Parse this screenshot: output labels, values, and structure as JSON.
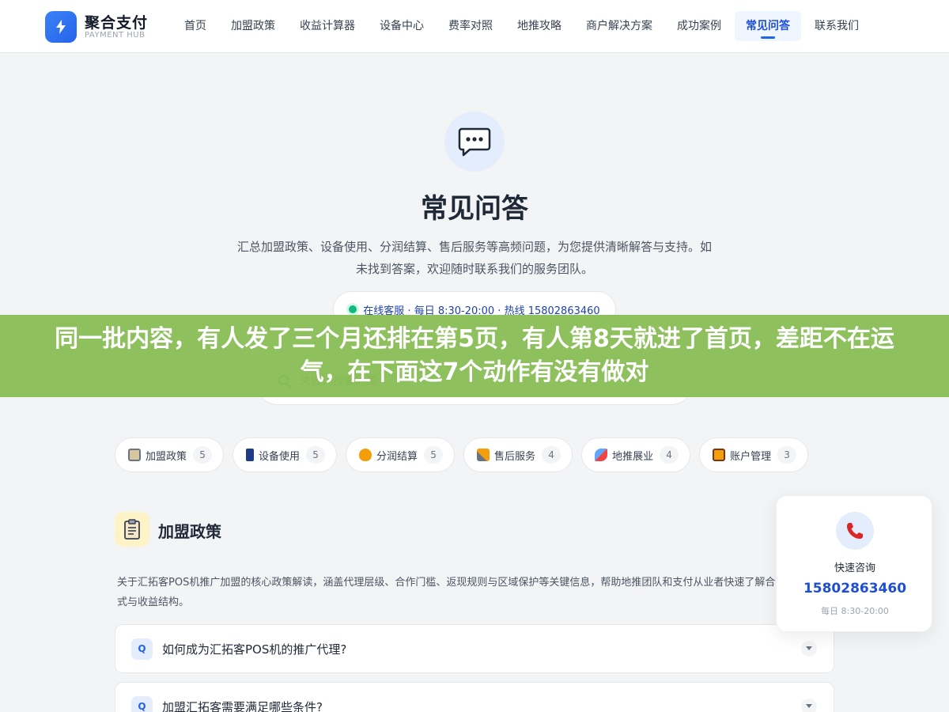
{
  "header": {
    "brand_name": "聚合支付",
    "brand_sub": "PAYMENT HUB",
    "logo_icon": "lightning-icon",
    "nav": [
      {
        "label": "首页"
      },
      {
        "label": "加盟政策"
      },
      {
        "label": "收益计算器"
      },
      {
        "label": "设备中心"
      },
      {
        "label": "费率对照"
      },
      {
        "label": "地推攻略"
      },
      {
        "label": "商户解决方案"
      },
      {
        "label": "成功案例"
      },
      {
        "label": "常见问答",
        "active": true
      },
      {
        "label": "联系我们"
      }
    ]
  },
  "hero": {
    "icon": "chat-bubble-icon",
    "title": "常见问答",
    "description": "汇总加盟政策、设备使用、分润结算、售后服务等高频问题，为您提供清晰解答与支持。如未找到答案，欢迎随时联系我们的服务团队。",
    "contact_line": "在线客服 · 每日 8:30-20:00 · 热线 15802863460",
    "search_placeholder": "关键词搜索问题"
  },
  "banner": {
    "text": "同一批内容，有人发了三个月还排在第5页，有人第8天就进了首页，差距不在运气，在下面这7个动作有没有做对"
  },
  "categories": [
    {
      "label": "加盟政策",
      "count": "5",
      "icon": "clipboard-icon"
    },
    {
      "label": "设备使用",
      "count": "5",
      "icon": "phone-icon"
    },
    {
      "label": "分润结算",
      "count": "5",
      "icon": "money-bag-icon"
    },
    {
      "label": "售后服务",
      "count": "4",
      "icon": "tools-icon"
    },
    {
      "label": "地推展业",
      "count": "4",
      "icon": "rocket-icon"
    },
    {
      "label": "账户管理",
      "count": "3",
      "icon": "lock-icon"
    }
  ],
  "section": {
    "icon": "clipboard-icon",
    "title": "加盟政策",
    "description": "关于汇拓客POS机推广加盟的核心政策解读，涵盖代理层级、合作门槛、返现规则与区域保护等关键信息，帮助地推团队和支付从业者快速了解合作模式与收益结构。"
  },
  "faqs": [
    {
      "badge": "Q",
      "question": "如何成为汇拓客POS机的推广代理?"
    },
    {
      "badge": "Q",
      "question": "加盟汇拓客需要满足哪些条件?"
    }
  ],
  "call_card": {
    "icon": "telephone-icon",
    "label": "快速咨询",
    "phone": "15802863460",
    "hours": "每日 8:30-20:00"
  },
  "colors": {
    "accent": "#2563eb",
    "banner": "#88bd54",
    "online_dot": "#10b981"
  }
}
